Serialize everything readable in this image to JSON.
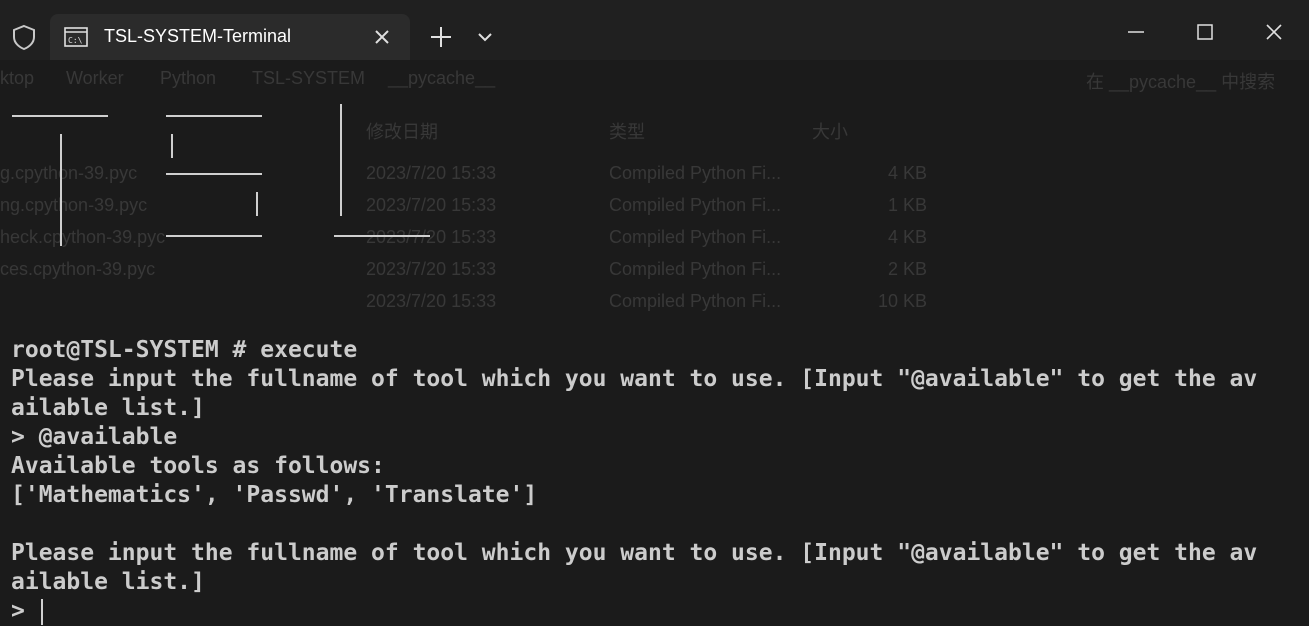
{
  "window": {
    "tab_title": "TSL-SYSTEM-Terminal",
    "tab_icon": "terminal-icon",
    "shield_icon": "shield-icon",
    "new_tab_icon": "plus-icon",
    "dropdown_icon": "chevron-down-icon",
    "controls": [
      "minimize-icon",
      "maximize-icon",
      "close-icon"
    ]
  },
  "background_explorer": {
    "breadcrumb": [
      "ktop",
      "Worker",
      "Python",
      "TSL-SYSTEM",
      "__pycache__"
    ],
    "search_placeholder": "在 __pycache__ 中搜索",
    "columns": [
      "修改日期",
      "类型",
      "大小"
    ],
    "files": [
      {
        "name": "g.cpython-39.pyc",
        "date": "2023/7/20 15:33",
        "type": "Compiled Python Fi...",
        "size": "4 KB"
      },
      {
        "name": "ng.cpython-39.pyc",
        "date": "2023/7/20 15:33",
        "type": "Compiled Python Fi...",
        "size": "1 KB"
      },
      {
        "name": "heck.cpython-39.pyc",
        "date": "2023/7/20 15:33",
        "type": "Compiled Python Fi...",
        "size": "4 KB"
      },
      {
        "name": "ces.cpython-39.pyc",
        "date": "2023/7/20 15:33",
        "type": "Compiled Python Fi...",
        "size": "2 KB"
      },
      {
        "name": "",
        "date": "2023/7/20 15:33",
        "type": "Compiled Python Fi...",
        "size": "10 KB"
      }
    ]
  },
  "terminal": {
    "lines": [
      "root@TSL-SYSTEM # execute",
      "Please input the fullname of tool which you want to use. [Input \"@available\" to get the av",
      "ailable list.]",
      "> @available",
      "Available tools as follows:",
      "['Mathematics', 'Passwd', 'Translate']",
      "",
      "Please input the fullname of tool which you want to use. [Input \"@available\" to get the av",
      "ailable list.]"
    ],
    "prompt": "> "
  },
  "colors": {
    "background": "#1b1b1b",
    "titlebar": "#202020",
    "tab": "#2b2b2b",
    "text": "#cccccc"
  }
}
